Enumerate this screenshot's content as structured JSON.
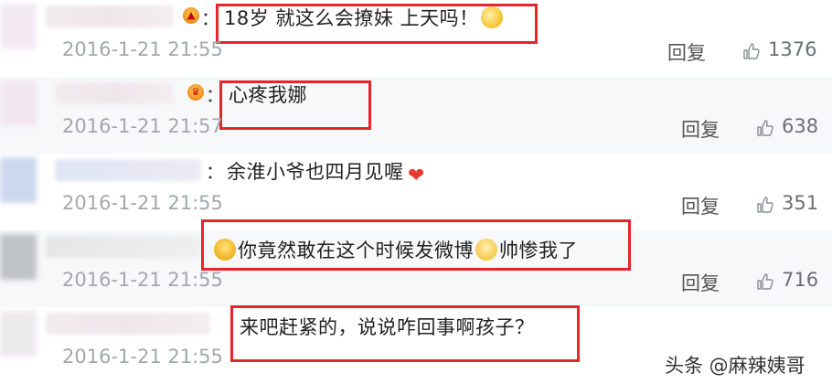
{
  "comments": [
    {
      "text": "18岁 就这么会撩妹 上天吗！",
      "emoji": "smile-face-icon",
      "time": "2016-1-21 21:55",
      "reply": "回复",
      "likes": "1376",
      "highlighted": true
    },
    {
      "text": "心疼我娜",
      "time": "2016-1-21 21:57",
      "reply": "回复",
      "likes": "638",
      "highlighted": true
    },
    {
      "text": "余淮小爷也四月见喔",
      "emoji": "heart-icon",
      "time": "2016-1-21 21:55",
      "reply": "回复",
      "likes": "351",
      "highlighted": false
    },
    {
      "text_part1": "你竟然敢在这个时候发微博",
      "text_part2": "帅惨我了",
      "time": "2016-1-21 21:55",
      "reply": "回复",
      "likes": "716",
      "highlighted": true
    },
    {
      "text": "来吧赶紧的，说说咋回事啊孩子？",
      "time": "2016-1-21 21:55",
      "highlighted": true
    }
  ],
  "colon": "：",
  "watermark": "头条 @麻辣姨哥",
  "colors": {
    "highlight_border": "#e4262e",
    "timestamp": "#a3a7ad",
    "background": "#ffffff"
  }
}
